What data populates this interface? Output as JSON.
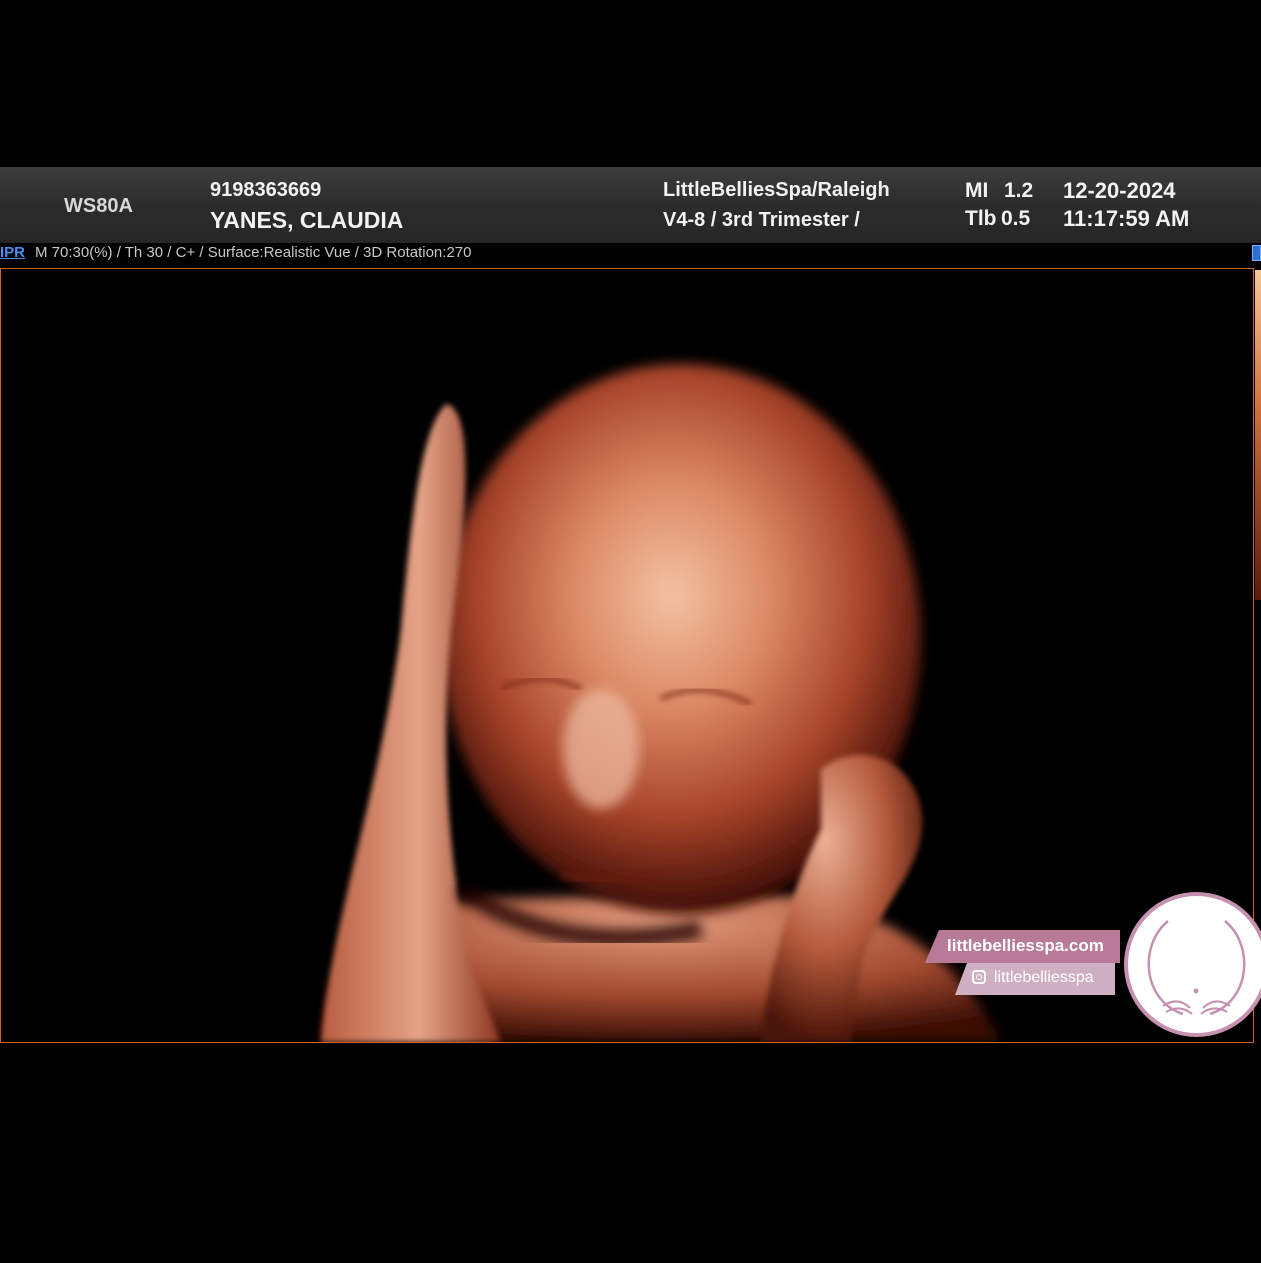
{
  "header": {
    "device": "WS80A",
    "patient_id": "9198363669",
    "patient_name": "YANES, CLAUDIA",
    "clinic": "LittleBelliesSpa/Raleigh",
    "probe_preset": "V4-8 / 3rd Trimester /",
    "mi_label": "MI",
    "mi_value": "1.2",
    "tib_label": "Tlb",
    "tib_value": "0.5",
    "date": "12-20-2024",
    "time": "11:17:59 AM"
  },
  "params": {
    "mode": "IPR",
    "text": "M 70:30(%) / Th 30 / C+ / Surface:Realistic Vue / 3D Rotation:270"
  },
  "watermark": {
    "website": "littlebelliesspa.com",
    "instagram_handle": "littlebelliesspa",
    "instagram_icon": "instagram-icon",
    "logo": "little-bellies-spa-logo"
  },
  "colors": {
    "header_bg": "#2c2c2c",
    "frame_border": "#c8672a",
    "mode_tag": "#4d8ef0",
    "brand_pink": "#b77a97"
  }
}
